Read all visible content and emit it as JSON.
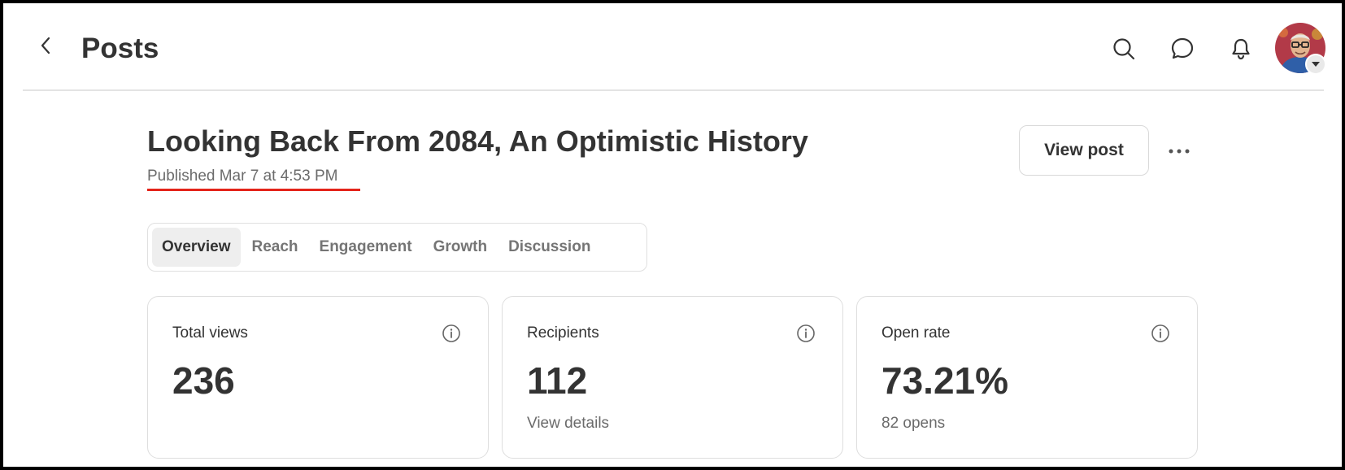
{
  "header": {
    "title": "Posts",
    "icons": [
      "chevron-left-icon",
      "search-icon",
      "chat-bubble-icon",
      "bell-icon",
      "caret-down-icon"
    ]
  },
  "post": {
    "title": "Looking Back From 2084, An Optimistic History",
    "published": "Published Mar 7 at 4:53 PM",
    "view_post_label": "View post",
    "underline_color": "#e4241a"
  },
  "tabs": [
    {
      "label": "Overview",
      "active": true
    },
    {
      "label": "Reach",
      "active": false
    },
    {
      "label": "Engagement",
      "active": false
    },
    {
      "label": "Growth",
      "active": false
    },
    {
      "label": "Discussion",
      "active": false
    }
  ],
  "cards": [
    {
      "label": "Total views",
      "value": "236",
      "sub": ""
    },
    {
      "label": "Recipients",
      "value": "112",
      "sub": "View details"
    },
    {
      "label": "Open rate",
      "value": "73.21%",
      "sub": "82 opens"
    }
  ]
}
